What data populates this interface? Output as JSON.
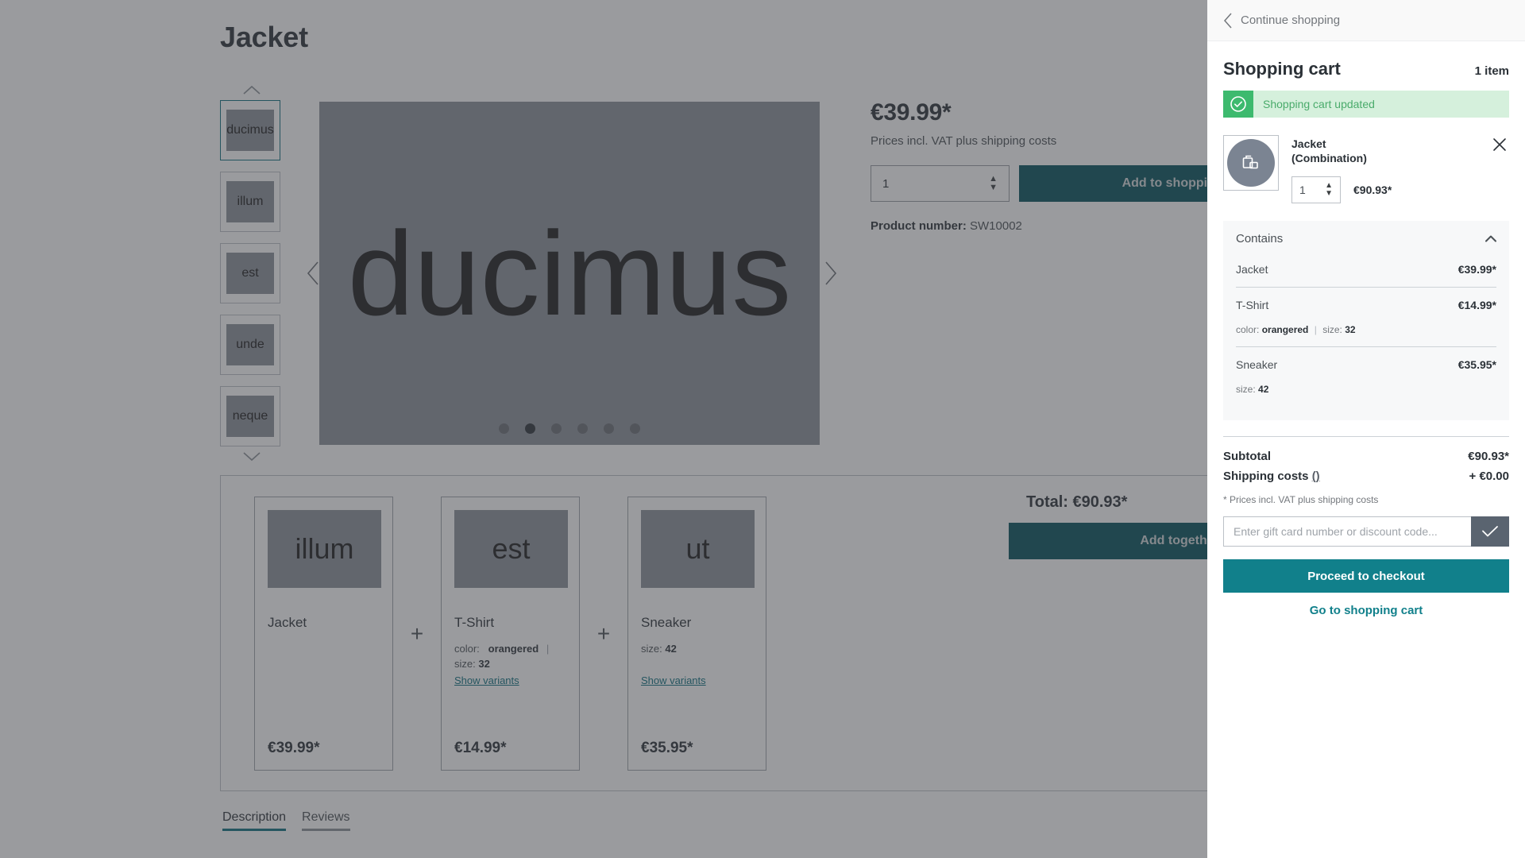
{
  "product": {
    "title": "Jacket",
    "price": "€39.99*",
    "vat_note": "Prices incl. VAT plus shipping costs",
    "quantity": "1",
    "add_to_cart_label": "Add to shopping cart",
    "product_number_label": "Product number:",
    "product_number": "SW10002"
  },
  "gallery": {
    "main_word": "ducimus",
    "thumbnails": [
      {
        "label": "ducimus",
        "active": true
      },
      {
        "label": "illum",
        "active": false
      },
      {
        "label": "est",
        "active": false
      },
      {
        "label": "unde",
        "active": false
      },
      {
        "label": "neque",
        "active": false
      }
    ],
    "dots": [
      {
        "active": false
      },
      {
        "active": true
      },
      {
        "active": false
      },
      {
        "active": false
      },
      {
        "active": false
      },
      {
        "active": false
      }
    ]
  },
  "bundle": {
    "total_label": "Total: €90.93*",
    "add_together_label": "Add together to shopping cart",
    "plus_symbol": "+",
    "cards": [
      {
        "image_word": "illum",
        "name": "Jacket",
        "options": [],
        "variants_label": "",
        "price": "€39.99*"
      },
      {
        "image_word": "est",
        "name": "T-Shirt",
        "options": [
          {
            "key": "color:",
            "value": "orangered"
          },
          {
            "key": "size:",
            "value": "32"
          }
        ],
        "variants_label": "Show variants",
        "price": "€14.99*"
      },
      {
        "image_word": "ut",
        "name": "Sneaker",
        "options": [
          {
            "key": "size:",
            "value": "42"
          }
        ],
        "variants_label": "Show variants",
        "price": "€35.95*"
      }
    ]
  },
  "tabs": [
    {
      "label": "Description",
      "active": true
    },
    {
      "label": "Reviews",
      "active": false
    }
  ],
  "cart": {
    "continue_shopping": "Continue shopping",
    "title": "Shopping cart",
    "item_count": "1 item",
    "alert_message": "Shopping cart updated",
    "item": {
      "name_line1": "Jacket",
      "name_line2": "(Combination)",
      "quantity": "1",
      "price": "€90.93*"
    },
    "contains_label": "Contains",
    "contains": [
      {
        "name": "Jacket",
        "price": "€39.99*",
        "options": []
      },
      {
        "name": "T-Shirt",
        "price": "€14.99*",
        "options": [
          {
            "key": "color:",
            "value": "orangered"
          },
          {
            "key": "size:",
            "value": "32"
          }
        ]
      },
      {
        "name": "Sneaker",
        "price": "€35.95*",
        "options": [
          {
            "key": "size:",
            "value": "42"
          }
        ]
      }
    ],
    "subtotal_label": "Subtotal",
    "subtotal_value": "€90.93*",
    "shipping_label": "Shipping costs",
    "shipping_link": "()",
    "shipping_value": "+ €0.00",
    "vat_note": "* Prices incl. VAT plus shipping costs",
    "promo_placeholder": "Enter gift card number or discount code...",
    "checkout_label": "Proceed to checkout",
    "go_to_cart_label": "Go to shopping cart"
  },
  "colors": {
    "accent_teal": "#11808b",
    "button_dark_teal": "#03505a",
    "success_green": "#3dba6e",
    "success_bg": "#d5f0dc",
    "text_dark": "#2b3137",
    "placeholder_gray": "#8b909a"
  }
}
